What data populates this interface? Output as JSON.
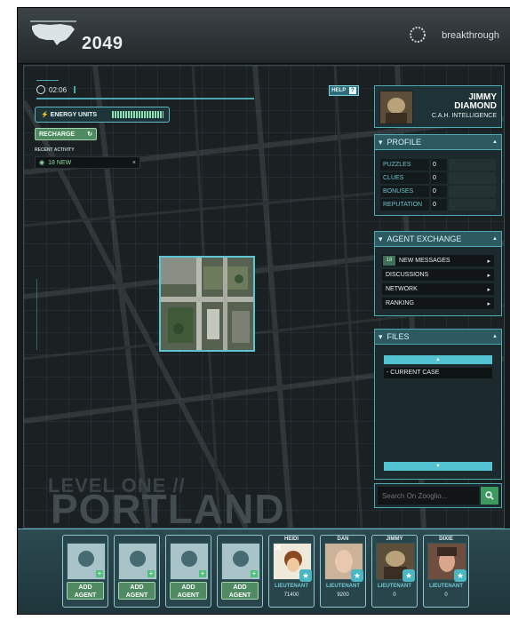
{
  "header": {
    "year": "2049",
    "brand": "breakthrough"
  },
  "hud": {
    "timer": "02:06",
    "help_label": "HELP",
    "help_icon": "?",
    "energy_label": "ENERGY UNITS",
    "recharge_label": "RECHARGE",
    "recent_activity_label": "RECENT ACTIVITY",
    "recent_activity_item": "18 NEW",
    "recent_close": "×"
  },
  "map": {
    "level_label": "LEVEL ONE //",
    "city": "PORTLAND"
  },
  "profile_card": {
    "first_name": "JIMMY",
    "last_name": "DIAMOND",
    "title": "C.A.H. INTELLIGENCE"
  },
  "profile": {
    "header": "PROFILE",
    "stats": [
      {
        "label": "PUZZLES",
        "value": "0"
      },
      {
        "label": "CLUES",
        "value": "0"
      },
      {
        "label": "BONUSES",
        "value": "0"
      },
      {
        "label": "REPUTATION",
        "value": "0"
      }
    ]
  },
  "agent_exchange": {
    "header": "AGENT EXCHANGE",
    "items": [
      {
        "label": "NEW MESSAGES",
        "badge": "18"
      },
      {
        "label": "DISCUSSIONS"
      },
      {
        "label": "NETWORK"
      },
      {
        "label": "RANKING"
      }
    ]
  },
  "files": {
    "header": "FILES",
    "items": [
      "- CURRENT CASE"
    ]
  },
  "search": {
    "placeholder": "Search On Zooglio..."
  },
  "agents": {
    "add_label_1": "ADD",
    "add_label_2": "AGENT",
    "empty_slots": 4,
    "members": [
      {
        "name": "HEIDI",
        "rank": "LIEUTENANT",
        "points": "71400"
      },
      {
        "name": "DAN",
        "rank": "LIEUTENANT",
        "points": "9200"
      },
      {
        "name": "JIMMY",
        "rank": "LIEUTENANT",
        "points": "0"
      },
      {
        "name": "DIXIE",
        "rank": "LIEUTENANT",
        "points": "0"
      }
    ]
  },
  "colors": {
    "accent": "#4ea8b4",
    "action_green": "#4f8a63"
  }
}
